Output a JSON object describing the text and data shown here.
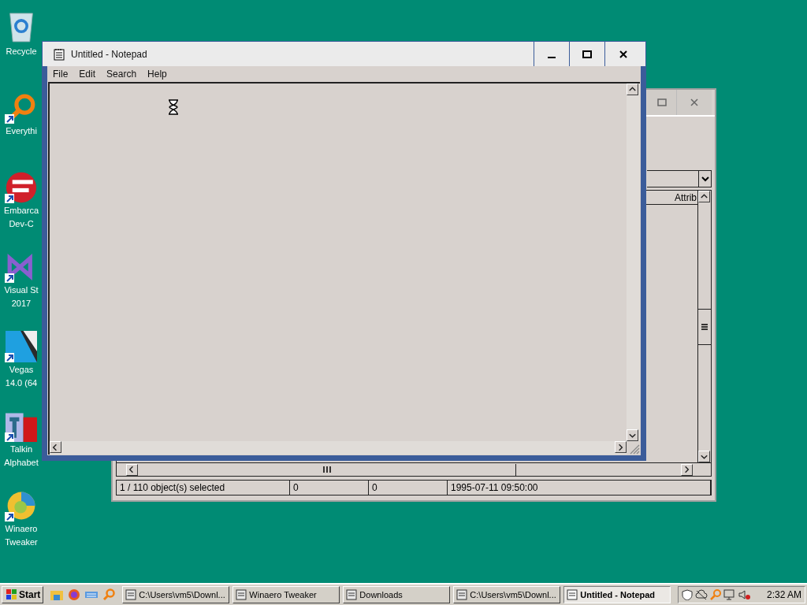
{
  "desktop_icons": [
    {
      "lines": [
        "Recycle"
      ],
      "shortcut": false
    },
    {
      "lines": [
        "Everythi"
      ],
      "shortcut": true
    },
    {
      "lines": [
        "Embarca",
        "Dev-C"
      ],
      "shortcut": true
    },
    {
      "lines": [
        "Visual St",
        "2017"
      ],
      "shortcut": true
    },
    {
      "lines": [
        "Vegas",
        "14.0 (64"
      ],
      "shortcut": true
    },
    {
      "lines": [
        "Talkin",
        "Alphabet"
      ],
      "shortcut": true
    },
    {
      "lines": [
        "Winaero",
        "Tweaker"
      ],
      "shortcut": true
    }
  ],
  "back_window": {
    "list_header": "Attrib",
    "status_bar": [
      "1 / 110 object(s) selected",
      "0",
      "0",
      "1995-07-11 09:50:00"
    ]
  },
  "notepad": {
    "title": "Untitled - Notepad",
    "menu": [
      "File",
      "Edit",
      "Search",
      "Help"
    ]
  },
  "taskbar": {
    "start": "Start",
    "tasks": [
      {
        "label": "C:\\Users\\vm5\\Downl...",
        "selected": false
      },
      {
        "label": "Winaero Tweaker",
        "selected": false
      },
      {
        "label": "Downloads",
        "selected": false
      },
      {
        "label": "C:\\Users\\vm5\\Downl...",
        "selected": false
      },
      {
        "label": "Untitled - Notepad",
        "selected": true
      }
    ],
    "clock": "2:32 AM"
  }
}
